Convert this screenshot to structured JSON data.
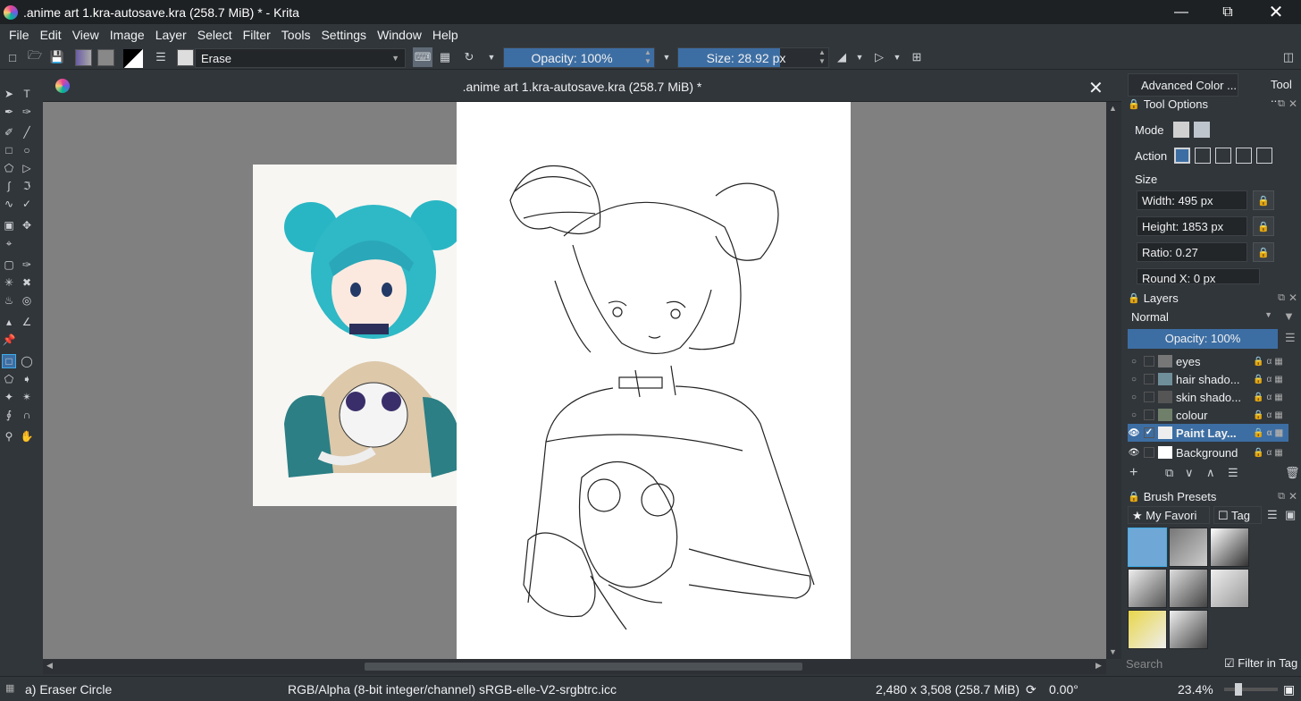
{
  "window": {
    "title": ".anime art 1.kra-autosave.kra (258.7 MiB) * - Krita"
  },
  "menu": [
    "File",
    "Edit",
    "View",
    "Image",
    "Layer",
    "Select",
    "Filter",
    "Tools",
    "Settings",
    "Window",
    "Help"
  ],
  "toolbar": {
    "blend_mode": "Erase",
    "opacity": "Opacity: 100%",
    "opacity_value": 1.0,
    "size": "Size: 28.92 px",
    "size_fill": 0.68
  },
  "document": {
    "tab_title": ".anime art 1.kra-autosave.kra (258.7 MiB) *"
  },
  "right_tabs": [
    "Advanced Color ...",
    "Tool ..."
  ],
  "tool_options": {
    "title": "Tool Options",
    "mode_label": "Mode",
    "action_label": "Action",
    "size_label": "Size",
    "width": "Width: 495 px",
    "height": "Height: 1853 px",
    "ratio": "Ratio: 0.27",
    "round_x": "Round X: 0 px"
  },
  "layers": {
    "title": "Layers",
    "blend": "Normal",
    "opacity": "Opacity:  100%",
    "items": [
      {
        "name": "eyes",
        "visible": false,
        "selected": false
      },
      {
        "name": "hair shado...",
        "visible": false,
        "selected": false
      },
      {
        "name": "skin shado...",
        "visible": false,
        "selected": false
      },
      {
        "name": "colour",
        "visible": false,
        "selected": false
      },
      {
        "name": "Paint Lay...",
        "visible": true,
        "selected": true
      },
      {
        "name": "Background",
        "visible": true,
        "selected": false
      }
    ]
  },
  "brush_presets": {
    "title": "Brush Presets",
    "tag_filter": "My Favori",
    "tag_button": "Tag",
    "search_placeholder": "Search",
    "filter_in_tag": "Filter in Tag"
  },
  "status": {
    "brush": "a) Eraser Circle",
    "color_space": "RGB/Alpha (8-bit integer/channel)  sRGB-elle-V2-srgbtrc.icc",
    "dimensions": "2,480 x 3,508 (258.7 MiB)",
    "rotation": "0.00°",
    "zoom": "23.4%"
  },
  "colors": {
    "accent": "#3d6ea3",
    "bg": "#31363b",
    "canvas_bg": "#808080"
  }
}
